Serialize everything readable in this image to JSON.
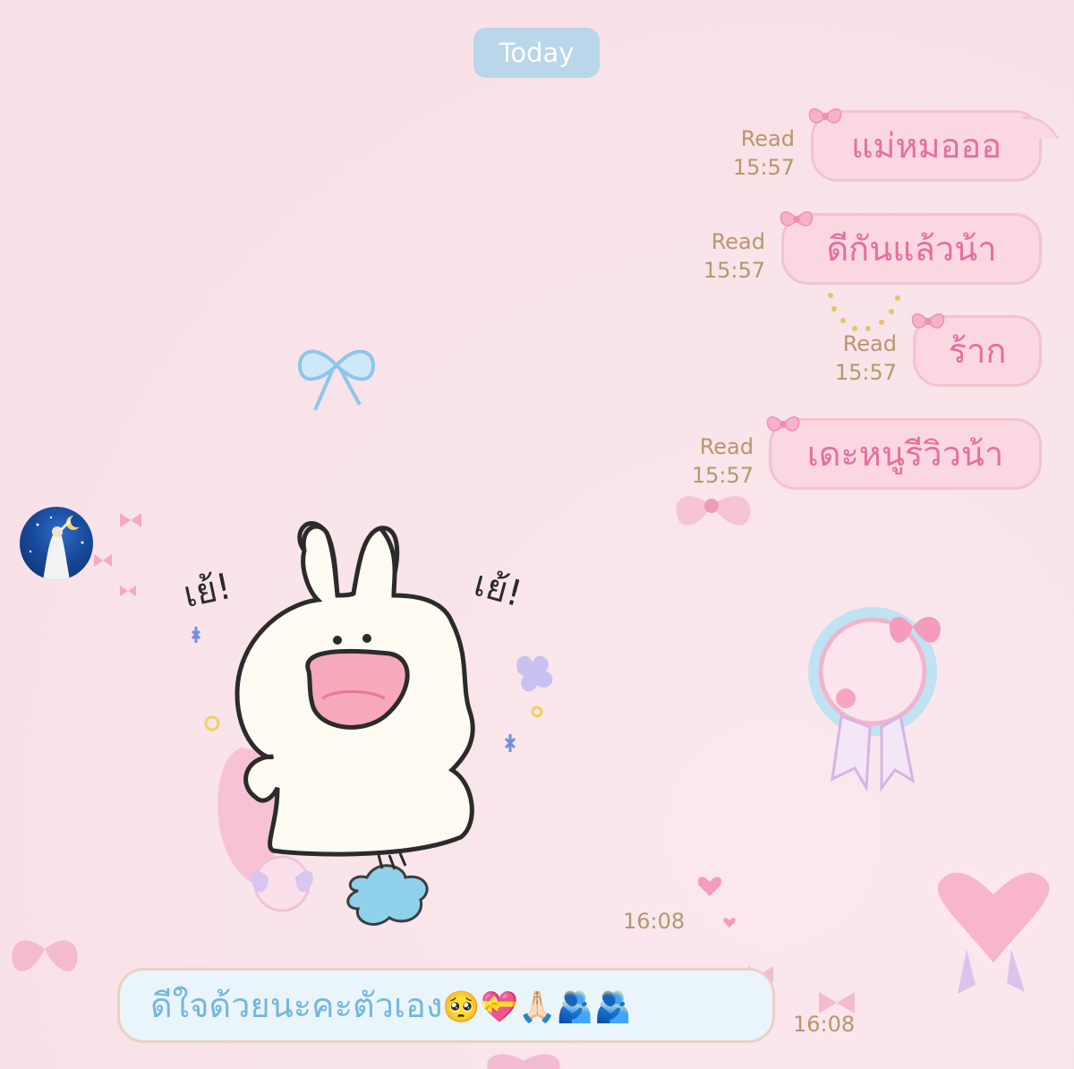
{
  "date_divider": "Today",
  "messages_out": [
    {
      "text": "แม่หมอออ",
      "status": "Read",
      "time": "15:57"
    },
    {
      "text": "ดีกันแล้วน้า",
      "status": "Read",
      "time": "15:57"
    },
    {
      "text": "ร้าก",
      "status": "Read",
      "time": "15:57"
    },
    {
      "text": "เดะหนูรีวิวน้า",
      "status": "Read",
      "time": "15:57"
    }
  ],
  "sticker": {
    "time": "16:08",
    "text_left": "เย้!",
    "text_right": "เย้!"
  },
  "message_in": {
    "text": "ดีใจด้วยนะคะตัวเอง",
    "emojis": "🥺💝🙏🏻🫂🫂",
    "time": "16:08"
  },
  "colors": {
    "background": "#f8e1e7",
    "out_bubble": "#fbd7e1",
    "out_text": "#e46fa0",
    "in_bubble": "#eaf5fb",
    "in_text": "#74b6de",
    "meta_text": "#b8966d",
    "date_pill": "#b9d6ea"
  }
}
